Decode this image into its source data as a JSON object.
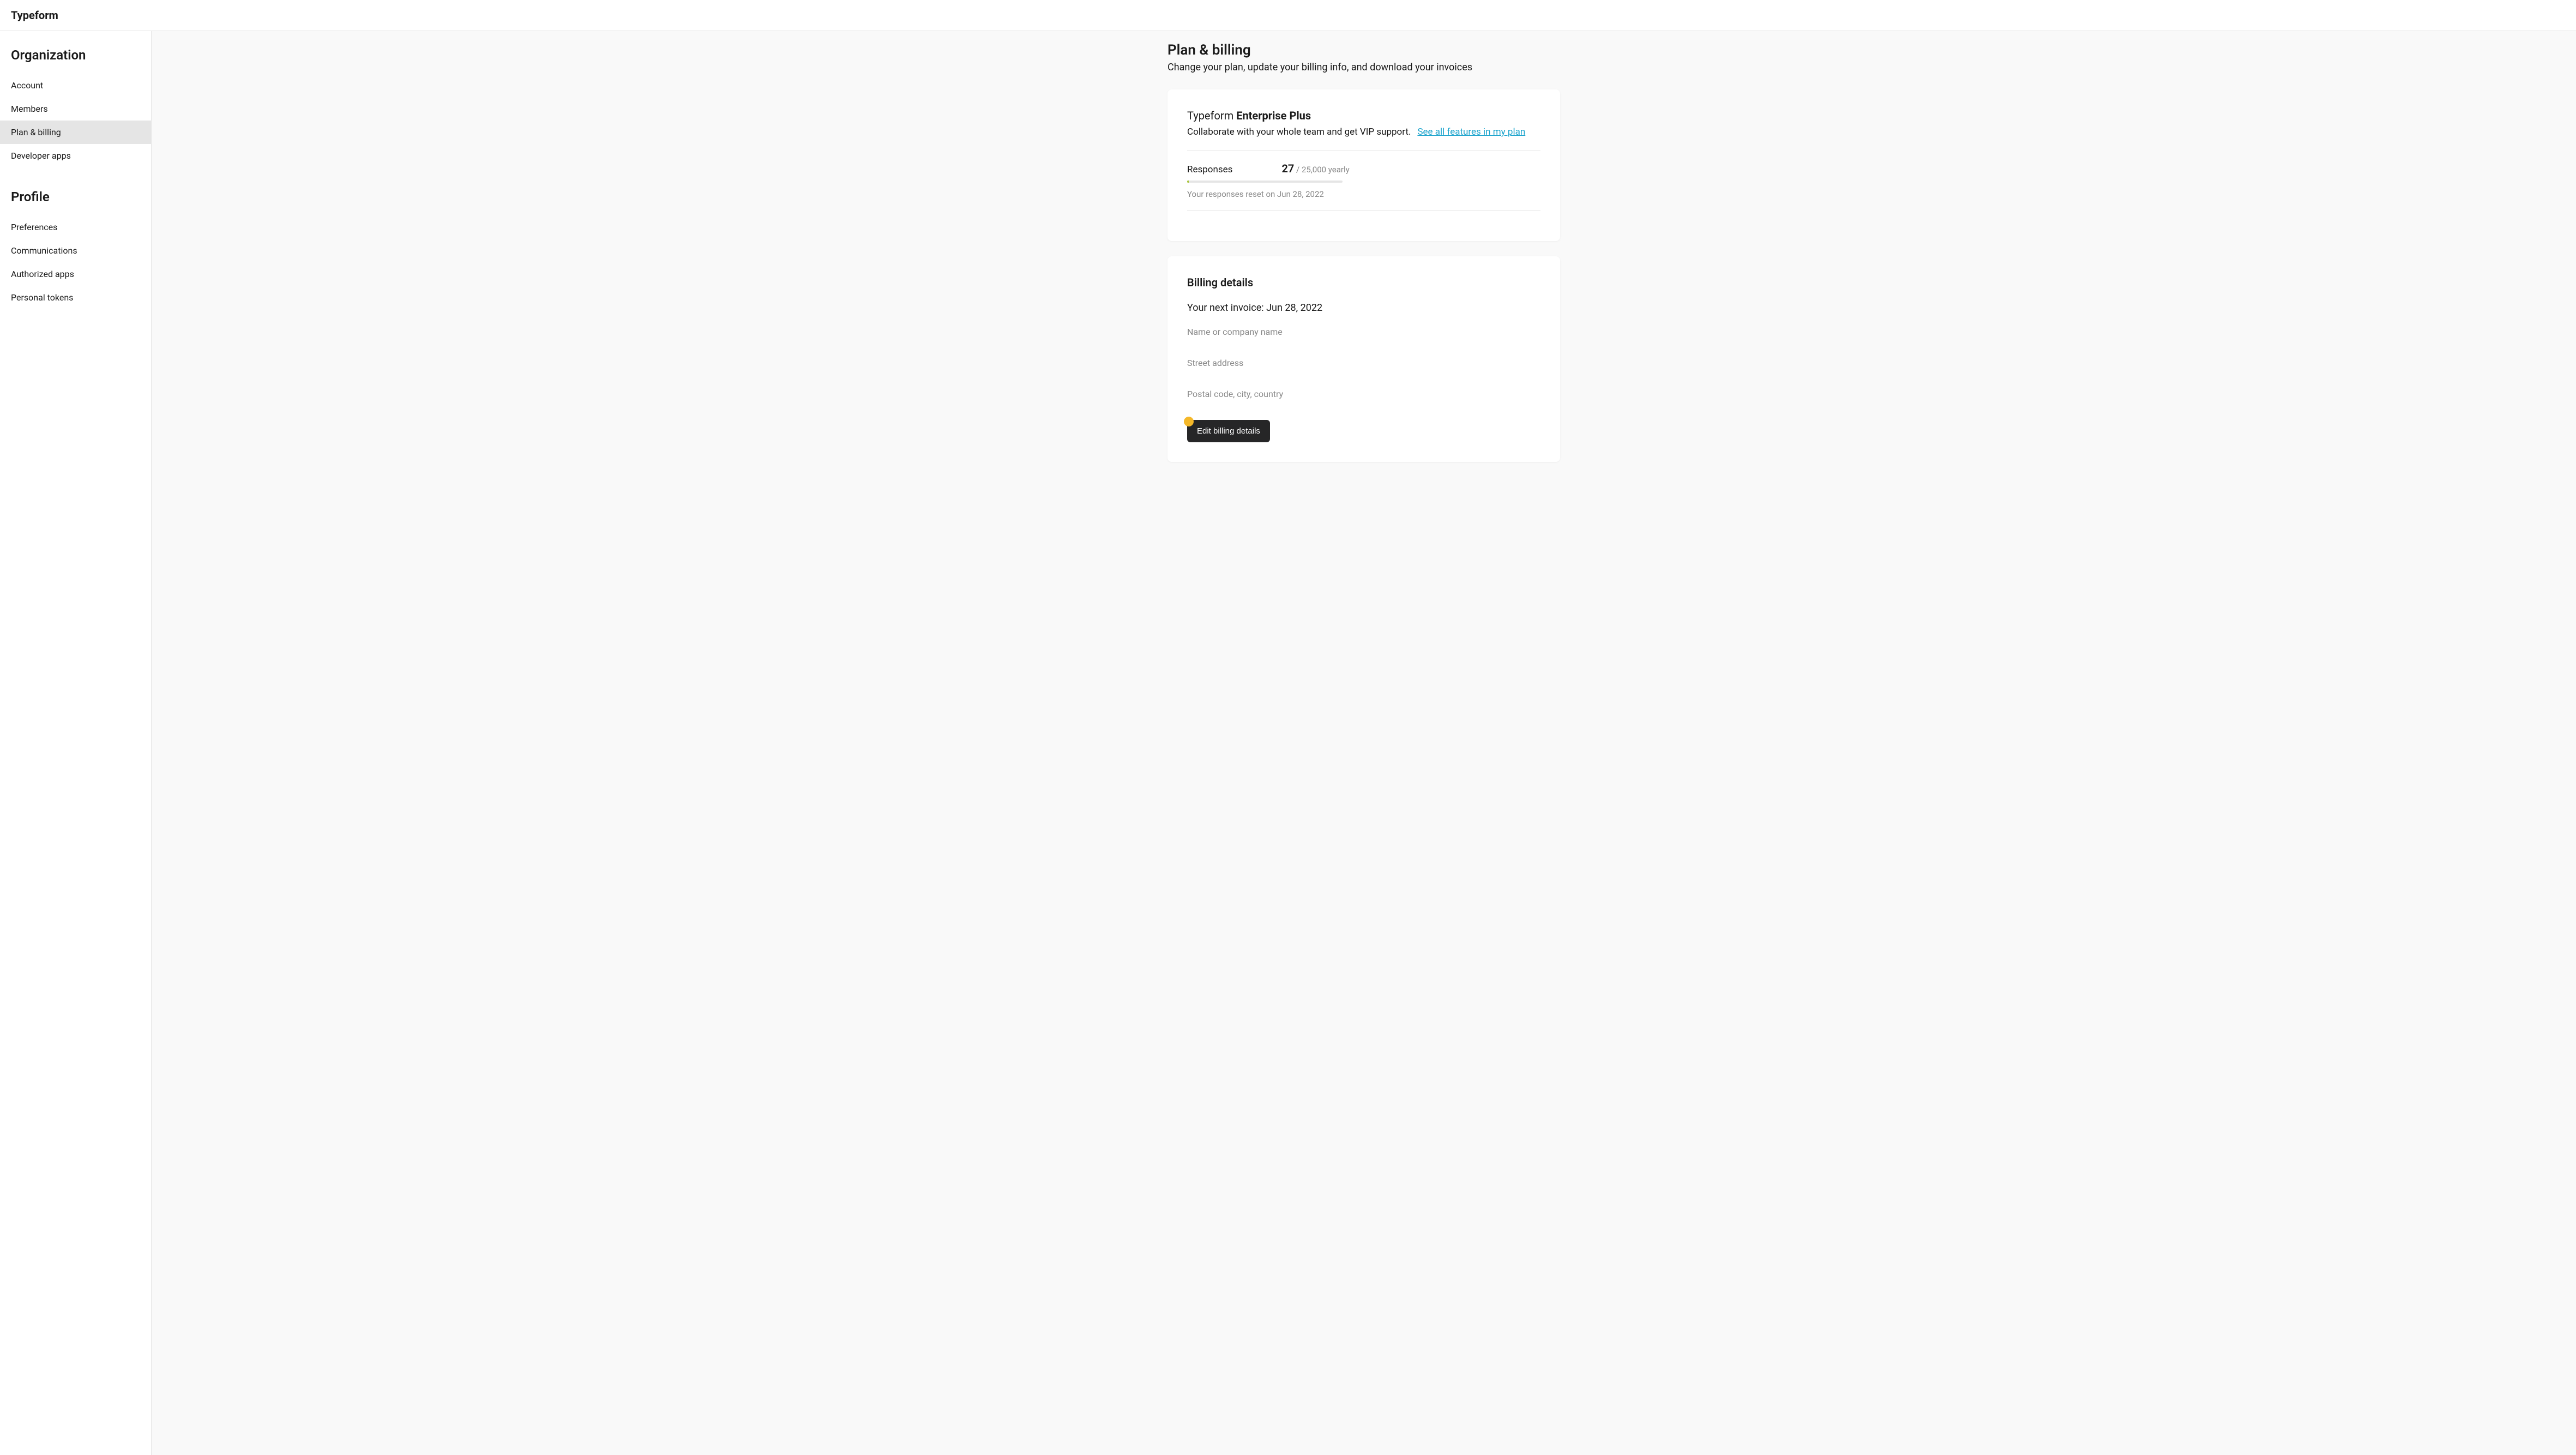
{
  "header": {
    "logo": "Typeform"
  },
  "sidebar": {
    "sections": [
      {
        "title": "Organization",
        "items": [
          {
            "label": "Account",
            "active": false
          },
          {
            "label": "Members",
            "active": false
          },
          {
            "label": "Plan & billing",
            "active": true
          },
          {
            "label": "Developer apps",
            "active": false
          }
        ]
      },
      {
        "title": "Profile",
        "items": [
          {
            "label": "Preferences",
            "active": false
          },
          {
            "label": "Communications",
            "active": false
          },
          {
            "label": "Authorized apps",
            "active": false
          },
          {
            "label": "Personal tokens",
            "active": false
          }
        ]
      }
    ]
  },
  "page": {
    "title": "Plan & billing",
    "subtitle": "Change your plan, update your billing info, and download your invoices"
  },
  "plan_card": {
    "brand": "Typeform",
    "tier": "Enterprise Plus",
    "description": "Collaborate with your whole team and get VIP support.",
    "features_link": "See all features in my plan",
    "usage": {
      "label": "Responses",
      "count": "27",
      "limit": " / 25,000 yearly",
      "reset_note": "Your responses reset on Jun 28, 2022"
    }
  },
  "billing_card": {
    "heading": "Billing details",
    "next_invoice": "Your next invoice: Jun 28, 2022",
    "fields": {
      "name": "Name or company name",
      "street": "Street address",
      "postal": "Postal code, city, country"
    },
    "edit_button": "Edit billing details"
  }
}
